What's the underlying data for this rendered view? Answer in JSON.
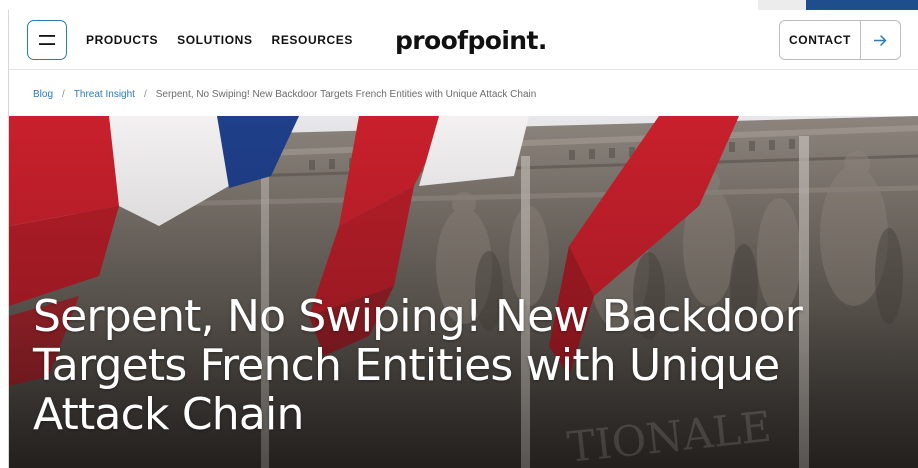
{
  "header": {
    "menu_icon": "hamburger-icon",
    "nav": [
      {
        "label": "PRODUCTS"
      },
      {
        "label": "SOLUTIONS"
      },
      {
        "label": "RESOURCES"
      }
    ],
    "logo_text": "proofpoint",
    "logo_dot": ".",
    "contact_label": "CONTACT",
    "contact_icon": "arrow-right-icon"
  },
  "breadcrumb": {
    "items": [
      "Blog",
      "Threat Insight"
    ],
    "separator": "/",
    "current": "Serpent, No Swiping! New Backdoor Targets French Entities with Unique Attack Chain"
  },
  "hero": {
    "title_lines": [
      "Serpent, No Swiping! New Backdoor",
      "Targets French Entities with Unique",
      "Attack Chain"
    ],
    "background_text": "TIONALE"
  },
  "colors": {
    "accent": "#2b7bb9",
    "header_strip_blue": "#1f4e8c",
    "text_dark": "#111111",
    "flag_red": "#c8202c",
    "flag_blue": "#1f3f8a",
    "flag_white": "#f2f0f0"
  }
}
